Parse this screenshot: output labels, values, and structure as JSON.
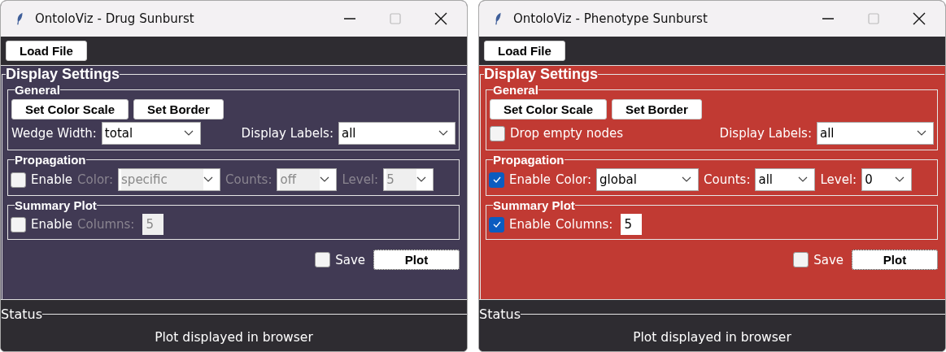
{
  "windows": [
    {
      "title": "OntoloViz - Drug Sunburst",
      "color": "#413a54",
      "load_button": "Load File",
      "display_settings": {
        "title": "Display Settings",
        "general": {
          "title": "General",
          "buttons": [
            "Set Color Scale",
            "Set Border"
          ],
          "options": [
            {
              "kind": "combo",
              "label": "Wedge Width:",
              "value": "total"
            }
          ],
          "display_labels": {
            "label": "Display Labels:",
            "value": "all"
          }
        },
        "propagation": {
          "title": "Propagation",
          "enable": {
            "label": "Enable",
            "checked": false
          },
          "fields": [
            {
              "label": "Color:",
              "value": "specific"
            },
            {
              "label": "Counts:",
              "value": "off"
            },
            {
              "label": "Level:",
              "value": "5"
            }
          ]
        },
        "summary_plot": {
          "title": "Summary Plot",
          "enable": {
            "label": "Enable",
            "checked": false
          },
          "columns": {
            "label": "Columns:",
            "value": "5"
          }
        },
        "save": {
          "label": "Save",
          "checked": false
        },
        "plot_button": "Plot"
      },
      "status": {
        "title": "Status",
        "message": "Plot displayed in browser"
      }
    },
    {
      "title": "OntoloViz - Phenotype Sunburst",
      "color": "#c13a33",
      "load_button": "Load File",
      "display_settings": {
        "title": "Display Settings",
        "general": {
          "title": "General",
          "buttons": [
            "Set Color Scale",
            "Set Border"
          ],
          "options": [
            {
              "kind": "checkbox",
              "label": "Drop empty nodes",
              "checked": false
            }
          ],
          "display_labels": {
            "label": "Display Labels:",
            "value": "all"
          }
        },
        "propagation": {
          "title": "Propagation",
          "enable": {
            "label": "Enable",
            "checked": true
          },
          "fields": [
            {
              "label": "Color:",
              "value": "global"
            },
            {
              "label": "Counts:",
              "value": "all"
            },
            {
              "label": "Level:",
              "value": "0"
            }
          ]
        },
        "summary_plot": {
          "title": "Summary Plot",
          "enable": {
            "label": "Enable",
            "checked": true
          },
          "columns": {
            "label": "Columns:",
            "value": "5"
          }
        },
        "save": {
          "label": "Save",
          "checked": false
        },
        "plot_button": "Plot"
      },
      "status": {
        "title": "Status",
        "message": "Plot displayed in browser"
      }
    }
  ]
}
